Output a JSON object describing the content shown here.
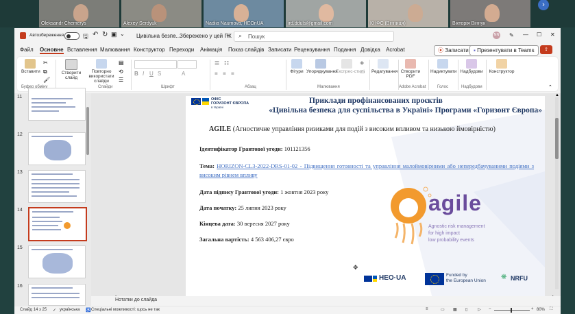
{
  "participants": [
    {
      "name": "Oleksandr Chemerys"
    },
    {
      "name": "Alexey Serdyuk"
    },
    {
      "name": "Nadiia Naumova, HEOnUA"
    },
    {
      "name": "ird.dduls@gmail.com"
    },
    {
      "name": "КНФС (Вінниця)"
    },
    {
      "name": "Вікторія Віннук"
    }
  ],
  "window": {
    "autosave_label": "Автозбереження",
    "doc_title": "Цивільна безпе...",
    "saved_status": "Збережено у цей ПК",
    "search_placeholder": "Пошук",
    "user_initials": "NN"
  },
  "menu_tabs": [
    "Файл",
    "Основне",
    "Вставлення",
    "Малювання",
    "Конструктор",
    "Переходи",
    "Анімація",
    "Показ слайдів",
    "Записати",
    "Рецензування",
    "Подання",
    "Довідка",
    "Acrobat"
  ],
  "record_button": "Записати",
  "present_teams_button": "Презентувати в Teams",
  "ribbon": {
    "paste": "Вставити",
    "new_slide": "Створити слайд",
    "reuse_slides": "Повторно використати слайди",
    "shapes": "Фігури",
    "arrange": "Упорядкування",
    "quick_styles": "Експрес-стилі",
    "editing": "Редагування",
    "create_pdf": "Створити PDF",
    "dictate": "Надиктувати",
    "addins": "Надбудови",
    "designer": "Конструктор",
    "groups": {
      "clipboard": "Буфер обміну",
      "slides": "Слайди",
      "font": "Шрифт",
      "paragraph": "Абзац",
      "drawing": "Малювання",
      "acrobat": "Adobe Acrobat",
      "voice": "Голос",
      "addins": "Надбудови"
    }
  },
  "thumbnails": [
    {
      "num": "11"
    },
    {
      "num": "12"
    },
    {
      "num": "13"
    },
    {
      "num": "14"
    },
    {
      "num": "15"
    },
    {
      "num": "16"
    }
  ],
  "slide": {
    "office_logo_line1": "ОФІС",
    "office_logo_line2": "ГОРИЗОНТ ЄВРОПА",
    "office_logo_line3": "в Україні",
    "title_line1": "Приклади профінансованих проєктів",
    "title_line2": "«Цивільна безпека для суспільства в Україні» Програми «Горизонт Європа»",
    "acronym": "AGILE",
    "acronym_expansion": "(Агностичне управління ризиками для подій з високим впливом та низькою ймовірністю)",
    "grant_id_label": "Ідентифікатор Грантової угоди:",
    "grant_id": "101121356",
    "topic_label": "Тема:",
    "topic": "HORIZON-CL3-2022-DRS-01-02 - Підвищення готовності та управління малоймовірними або непередбачуваними подіями з високим рівнем впливу",
    "sign_date_label": "Дата підпису Грантової угоди:",
    "sign_date": "1 жовтня 2023 року",
    "start_label": "Дата початку:",
    "start": "25 липня 2023 року",
    "end_label": "Кінцева дата:",
    "end": "30 вересня 2027 року",
    "cost_label": "Загальна вартість:",
    "cost": "4 563 406,27 євро",
    "agile_logo_text": "agile",
    "agile_tagline_1": "Agnostic risk management",
    "agile_tagline_2": "for high impact",
    "agile_tagline_3": "low probability events",
    "heo_logo": "HEO·UA",
    "eu_line1": "Funded by",
    "eu_line2": "the European Union",
    "nrfu_logo": "NRFU"
  },
  "notes_placeholder": "Нотатки до слайда",
  "status": {
    "slide_counter": "Слайд 14 з 25",
    "language": "українська",
    "accessibility": "Спеціальні можливості: щось не так",
    "zoom": "80%"
  },
  "colors": {
    "accent": "#c43b1d",
    "slide_title": "#1f3864",
    "agile_orange": "#f29a2e",
    "agile_purple": "#6a4c9c"
  }
}
